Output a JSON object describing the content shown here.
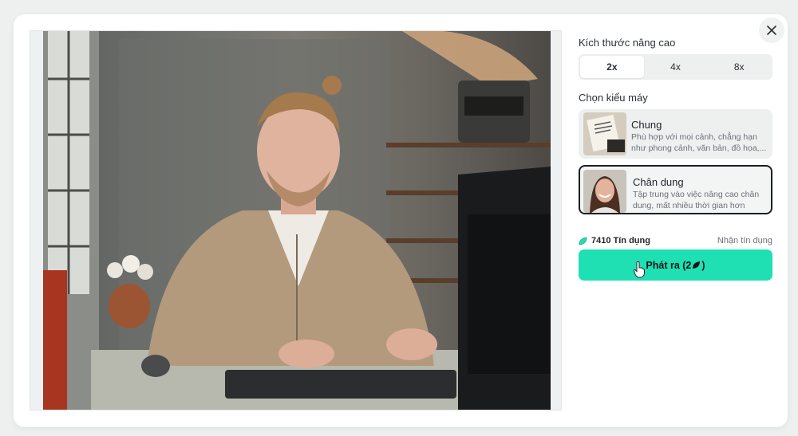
{
  "dialog": {
    "close_icon": "close-icon"
  },
  "preview": {
    "alt": "Man in beige sweater sitting at desk with computer"
  },
  "upscale": {
    "label": "Kích thước nâng cao",
    "options": [
      "2x",
      "4x",
      "8x"
    ],
    "selected": "2x"
  },
  "models": {
    "label": "Chọn kiểu máy",
    "items": [
      {
        "title": "Chung",
        "description": "Phù hợp với mọi cảnh, chẳng hạn như phong cảnh, văn bản, đồ họa,...",
        "selected": false
      },
      {
        "title": "Chân dung",
        "description": "Tập trung vào việc nâng cao chân dung, mất nhiều thời gian hơn",
        "selected": true
      }
    ]
  },
  "credits": {
    "balance": "7410 Tín dụng",
    "get_label": "Nhận tín dụng",
    "icon": "credit-leaf-icon"
  },
  "generate": {
    "label": "Phát ra (2",
    "suffix": ")",
    "icon": "credit-leaf-icon"
  },
  "colors": {
    "accent": "#1ee0b2",
    "selected_border": "#1c1f23"
  }
}
